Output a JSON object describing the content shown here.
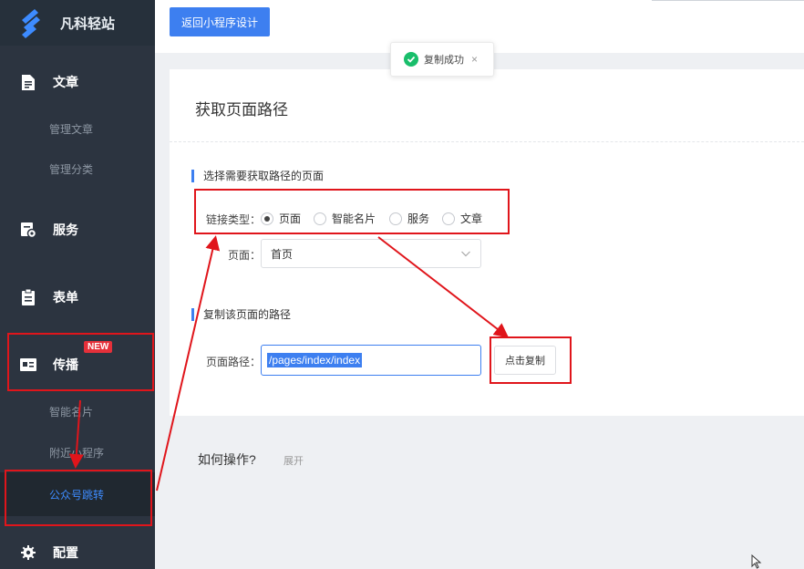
{
  "brand": {
    "name": "凡科轻站",
    "logo": "brand-logo-icon"
  },
  "sidebar": {
    "groups": [
      {
        "label": "文章",
        "icon": "document-icon"
      },
      {
        "label": "服务",
        "icon": "service-icon"
      },
      {
        "label": "表单",
        "icon": "clipboard-icon"
      },
      {
        "label": "传播",
        "icon": "id-card-icon",
        "badge": "NEW"
      },
      {
        "label": "配置",
        "icon": "gear-icon"
      }
    ],
    "subs": {
      "article": [
        "管理文章",
        "管理分类"
      ],
      "spread": [
        "智能名片",
        "附近小程序",
        "公众号跳转"
      ]
    },
    "active_sub": "公众号跳转"
  },
  "topbar": {
    "back_label": "返回小程序设计"
  },
  "toast": {
    "text": "复制成功",
    "icon": "check-circle-icon",
    "close": "×"
  },
  "card": {
    "title": "获取页面路径",
    "section1": "选择需要获取路径的页面",
    "link_type_label": "链接类型：",
    "link_types": [
      "页面",
      "智能名片",
      "服务",
      "文章"
    ],
    "selected_link_type": "页面",
    "page_label": "页面：",
    "page_value": "首页",
    "section2": "复制该页面的路径",
    "path_label": "页面路径：",
    "path_value": "/pages/index/index",
    "copy_label": "点击复制"
  },
  "howto": {
    "title": "如何操作?",
    "expand": "展开"
  },
  "colors": {
    "accent": "#3d7ff0",
    "annotation": "#e0151b",
    "sidebar": "#2c3440",
    "success": "#19be6b"
  }
}
